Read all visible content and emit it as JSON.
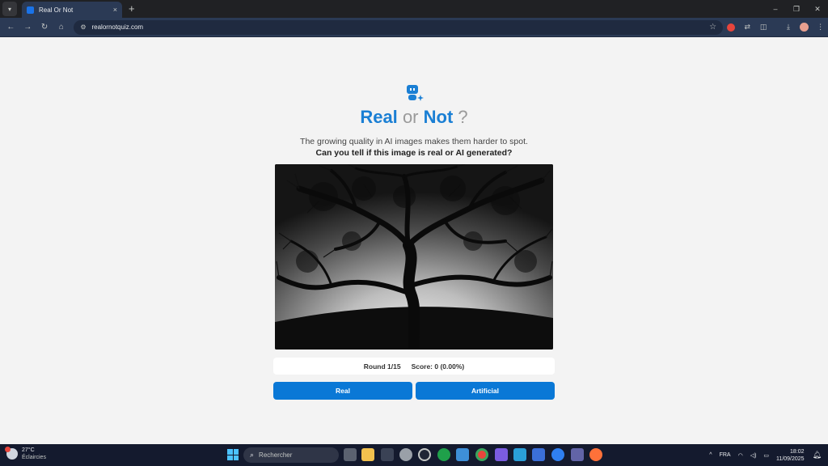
{
  "browser": {
    "tab_title": "Real Or Not",
    "tab_close": "×",
    "new_tab": "+",
    "url": "realornotquiz.com",
    "window_controls": [
      "–",
      "❐",
      "✕"
    ]
  },
  "page": {
    "title_real": "Real",
    "title_or": "or",
    "title_not": "Not",
    "title_q": "?",
    "subtitle": "The growing quality in AI images makes them harder to spot.",
    "question": "Can you tell if this image is real or AI generated?",
    "round": "Round 1/15",
    "score": "Score: 0 (0.00%)",
    "btn_real": "Real",
    "btn_artificial": "Artificial",
    "accent_color": "#1a7fd4",
    "button_color": "#0a78d6"
  },
  "taskbar": {
    "weather_temp": "27°C",
    "weather_desc": "Éclaircies",
    "search_placeholder": "Rechercher",
    "language": "FRA",
    "time": "18:02",
    "date": "11/09/2025"
  }
}
